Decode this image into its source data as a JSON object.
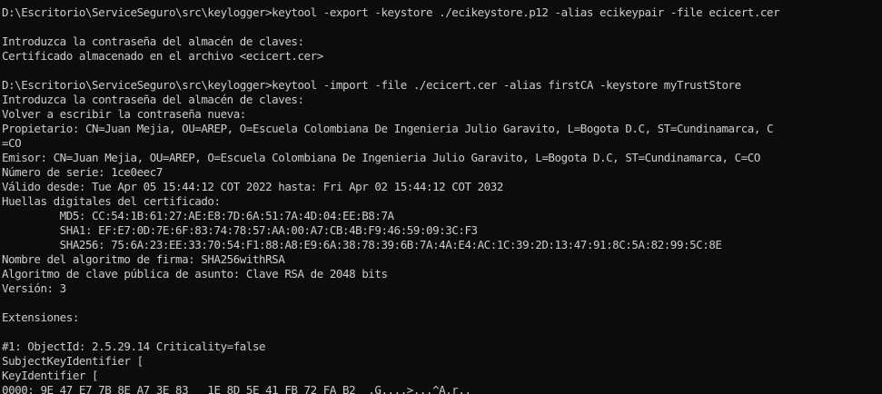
{
  "terminal": {
    "lines": [
      "D:\\Escritorio\\ServiceSeguro\\src\\keylogger>keytool -export -keystore ./ecikeystore.p12 -alias ecikeypair -file ecicert.cer",
      "",
      "Introduzca la contraseña del almacén de claves:",
      "Certificado almacenado en el archivo <ecicert.cer>",
      "",
      "D:\\Escritorio\\ServiceSeguro\\src\\keylogger>keytool -import -file ./ecicert.cer -alias firstCA -keystore myTrustStore",
      "Introduzca la contraseña del almacén de claves:",
      "Volver a escribir la contraseña nueva:",
      "Propietario: CN=Juan Mejia, OU=AREP, O=Escuela Colombiana De Ingenieria Julio Garavito, L=Bogota D.C, ST=Cundinamarca, C",
      "=CO",
      "Emisor: CN=Juan Mejia, OU=AREP, O=Escuela Colombiana De Ingenieria Julio Garavito, L=Bogota D.C, ST=Cundinamarca, C=CO",
      "Número de serie: 1ce0eec7",
      "Válido desde: Tue Apr 05 15:44:12 COT 2022 hasta: Fri Apr 02 15:44:12 COT 2032",
      "Huellas digitales del certificado:",
      "         MD5: CC:54:1B:61:27:AE:E8:7D:6A:51:7A:4D:04:EE:B8:7A",
      "         SHA1: EF:E7:0D:7E:6F:83:74:78:57:AA:00:A7:CB:4B:F9:46:59:09:3C:F3",
      "         SHA256: 75:6A:23:EE:33:70:54:F1:88:A8:E9:6A:38:78:39:6B:7A:4A:E4:AC:1C:39:2D:13:47:91:8C:5A:82:99:5C:8E",
      "Nombre del algoritmo de firma: SHA256withRSA",
      "Algoritmo de clave pública de asunto: Clave RSA de 2048 bits",
      "Versión: 3",
      "",
      "Extensiones:",
      "",
      "#1: ObjectId: 2.5.29.14 Criticality=false",
      "SubjectKeyIdentifier [",
      "KeyIdentifier [",
      "0000: 9E 47 E7 7B 8E A7 3E 83   1E 8D 5E 41 FB 72 FA B2  .G....>...^A.r.."
    ]
  }
}
